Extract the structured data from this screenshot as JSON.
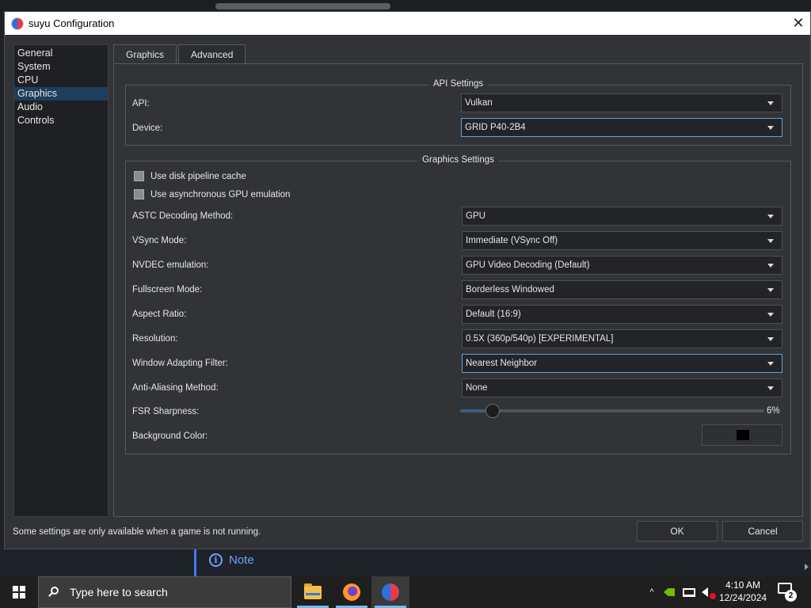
{
  "window": {
    "title": "suyu Configuration",
    "close_glyph": "✕"
  },
  "sidebar": {
    "items": [
      {
        "label": "General"
      },
      {
        "label": "System"
      },
      {
        "label": "CPU"
      },
      {
        "label": "Graphics",
        "active": true
      },
      {
        "label": "Audio"
      },
      {
        "label": "Controls"
      }
    ]
  },
  "tabs": [
    {
      "label": "Graphics",
      "active": true
    },
    {
      "label": "Advanced"
    }
  ],
  "api_settings": {
    "title": "API Settings",
    "api_label": "API:",
    "api_value": "Vulkan",
    "device_label": "Device:",
    "device_value": "GRID P40-2B4"
  },
  "graphics_settings": {
    "title": "Graphics Settings",
    "disk_cache_label": "Use disk pipeline cache",
    "async_gpu_label": "Use asynchronous GPU emulation",
    "astc_label": "ASTC Decoding Method:",
    "astc_value": "GPU",
    "vsync_label": "VSync Mode:",
    "vsync_value": "Immediate (VSync Off)",
    "nvdec_label": "NVDEC emulation:",
    "nvdec_value": "GPU Video Decoding (Default)",
    "fullscreen_label": "Fullscreen Mode:",
    "fullscreen_value": "Borderless Windowed",
    "aspect_label": "Aspect Ratio:",
    "aspect_value": "Default (16:9)",
    "resolution_label": "Resolution:",
    "resolution_value": "0.5X (360p/540p) [EXPERIMENTAL]",
    "filter_label": "Window Adapting Filter:",
    "filter_value": "Nearest Neighbor",
    "aa_label": "Anti-Aliasing Method:",
    "aa_value": "None",
    "fsr_label": "FSR Sharpness:",
    "fsr_value_text": "6%",
    "fsr_value": 0.06,
    "bg_color_label": "Background Color:",
    "bg_color": "#000000"
  },
  "footer": {
    "note": "Some settings are only available when a game is not running.",
    "ok_label": "OK",
    "cancel_label": "Cancel"
  },
  "background_page": {
    "note_label": "Note",
    "note_icon": "i"
  },
  "taskbar": {
    "search_placeholder": "Type here to search",
    "time": "4:10 AM",
    "date": "12/24/2024",
    "notification_count": "2",
    "tray_chevron": "^"
  },
  "colors": {
    "accent": "#5ea4d6",
    "selection": "#1d3e5c",
    "taskbar_highlight": "#76b9ed"
  }
}
